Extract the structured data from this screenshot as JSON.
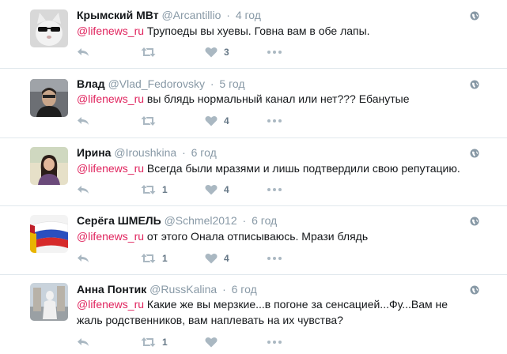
{
  "tweets": [
    {
      "name": "Крымский МВт",
      "handle": "@Arcantillio",
      "time": "4 год",
      "mention": "@lifenews_ru",
      "text": " Трупоеды вы хуевы. Говна вам в обе лапы.",
      "text2": "",
      "retweets": "",
      "likes": "3",
      "avatar": "cat-sunglasses"
    },
    {
      "name": "Влад",
      "handle": "@Vlad_Fedorovsky",
      "time": "5 год",
      "mention": "@lifenews_ru",
      "text": " вы блядь нормальный канал или нет??? Ебанутые",
      "text2": "",
      "retweets": "",
      "likes": "4",
      "avatar": "man-in-car"
    },
    {
      "name": "Ирина",
      "handle": "@Iroushkina",
      "time": "6 год",
      "mention": "@lifenews_ru",
      "text": " Всегда были мразями и лишь подтвердили свою репутацию.",
      "text2": "",
      "retweets": "1",
      "likes": "4",
      "avatar": "woman-outdoors"
    },
    {
      "name": "Серёга ШМЕЛЬ",
      "handle": "@Schmel2012",
      "time": "6 год",
      "mention": "@lifenews_ru",
      "text": " от этого Онала отписываюсь. Мрази блядь",
      "text2": "",
      "retweets": "1",
      "likes": "4",
      "avatar": "flags"
    },
    {
      "name": "Анна Понтик",
      "handle": "@RussKalina",
      "time": "6 год",
      "mention": "@lifenews_ru",
      "text": " Какие же вы мерзкие...в погоне за сенсацией...Фу...Вам не",
      "text2": "жаль родственников, вам наплевать на их чувства?",
      "retweets": "1",
      "likes": "",
      "avatar": "person-statue"
    }
  ],
  "colors": {
    "mention": "#e0245e",
    "meta": "#8899a6",
    "icon": "#aab8c2",
    "divider": "#e1e8ed"
  }
}
